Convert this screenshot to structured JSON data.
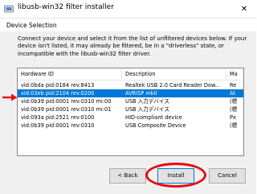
{
  "window": {
    "title": "libusb-win32 filter installer",
    "close_glyph": "✕"
  },
  "section": {
    "title": "Device Selection",
    "description": "Connect your device and select it from the list of unfiltered devices below. If your device isn't listed, it may already be filtered, be in a \"driverless\" state, or incompatible with the libusb-win32 filter driver."
  },
  "table": {
    "columns": [
      "Hardware ID",
      "Description",
      "Ma"
    ],
    "rows": [
      [
        "vid:0bda pid:0184 rev:8413",
        "Realtek USB 2.0 Card Reader Dow...",
        "Re"
      ],
      [
        "vid:03eb pid:2104 rev:0200",
        "AVRISP mkII",
        "At"
      ],
      [
        "vid:0b39 pid:0001 rev:0310 mi:00",
        "USB 入力デバイス",
        "(標"
      ],
      [
        "vid:0b39 pid:0001 rev:0310 mi:01",
        "USB 入力デバイス",
        "(標"
      ],
      [
        "vid:093a pid:2521 rev:0100",
        "HID-compliant device",
        "Px"
      ],
      [
        "vid:0b39 pid:0001 rev:0310",
        "USB Composite Device",
        "(標"
      ]
    ],
    "selected_index": 1
  },
  "buttons": {
    "back": "< Back",
    "install": "Install",
    "cancel": "Cancel"
  },
  "colors": {
    "selection": "#0078d7",
    "annotation_red": "#e30d16"
  },
  "icons": {
    "app": "usb-app-icon",
    "annotation_arrow": "red-arrow-icon"
  }
}
